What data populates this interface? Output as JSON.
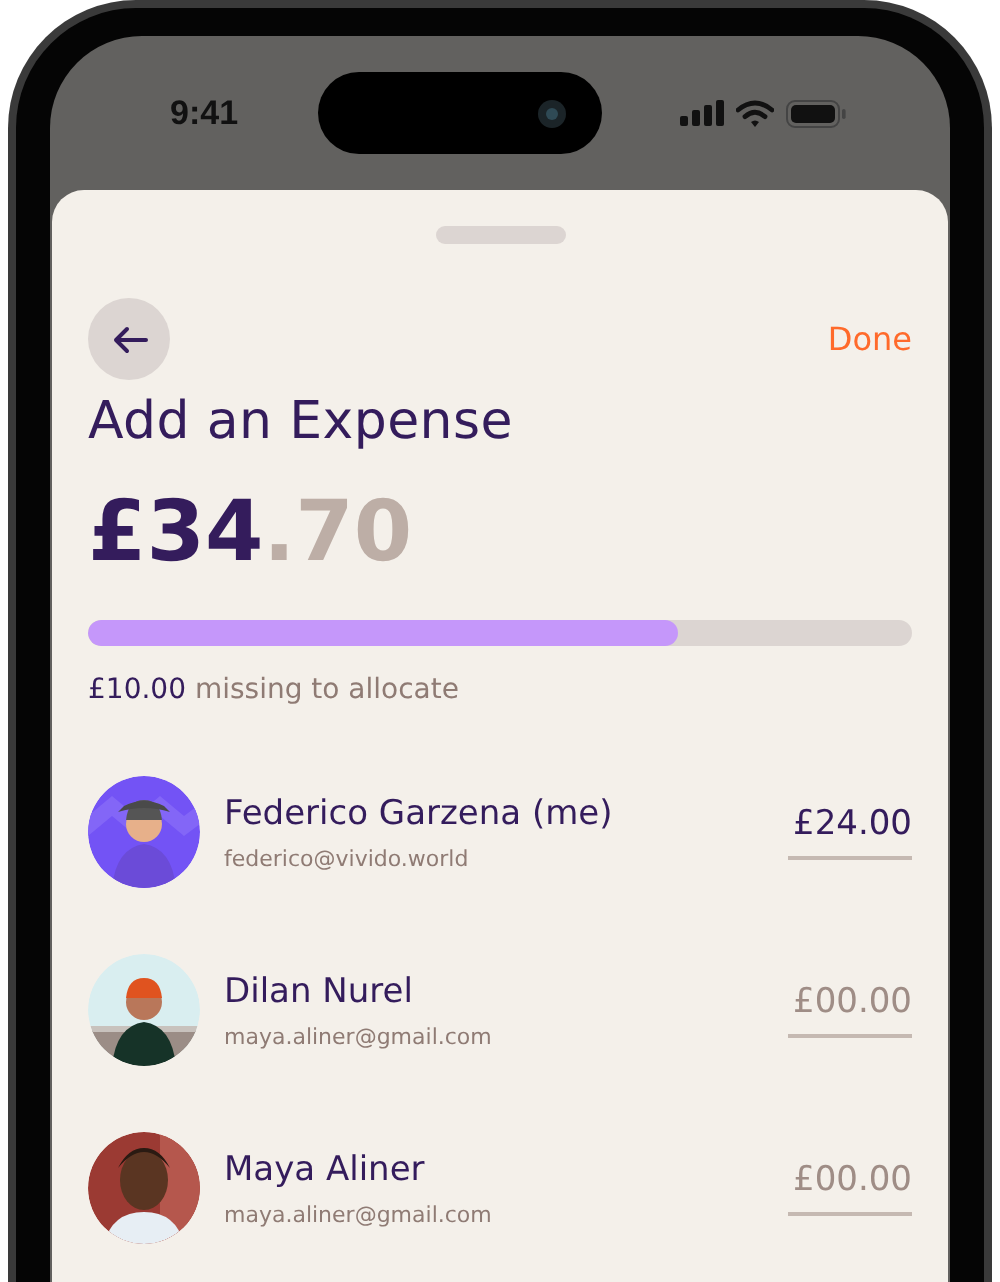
{
  "status_bar": {
    "time": "9:41"
  },
  "header": {
    "action": "Done"
  },
  "title": "Add an Expense",
  "total": {
    "whole": "£34",
    "cents": ".70"
  },
  "allocation": {
    "level": 0.716,
    "note": "**£10.00** missing to allocate"
  },
  "participants": [
    {
      "name": "Federico Garzena (me)",
      "email": "federico@vivido.world",
      "amount": "£24.00"
    },
    {
      "name": "Dilan Nurel",
      "email": "maya.aliner@gmail.com",
      "placeholder": "£00.00"
    },
    {
      "name": "Maya Aliner",
      "email": "maya.aliner@gmail.com",
      "placeholder": "£00.00"
    }
  ]
}
